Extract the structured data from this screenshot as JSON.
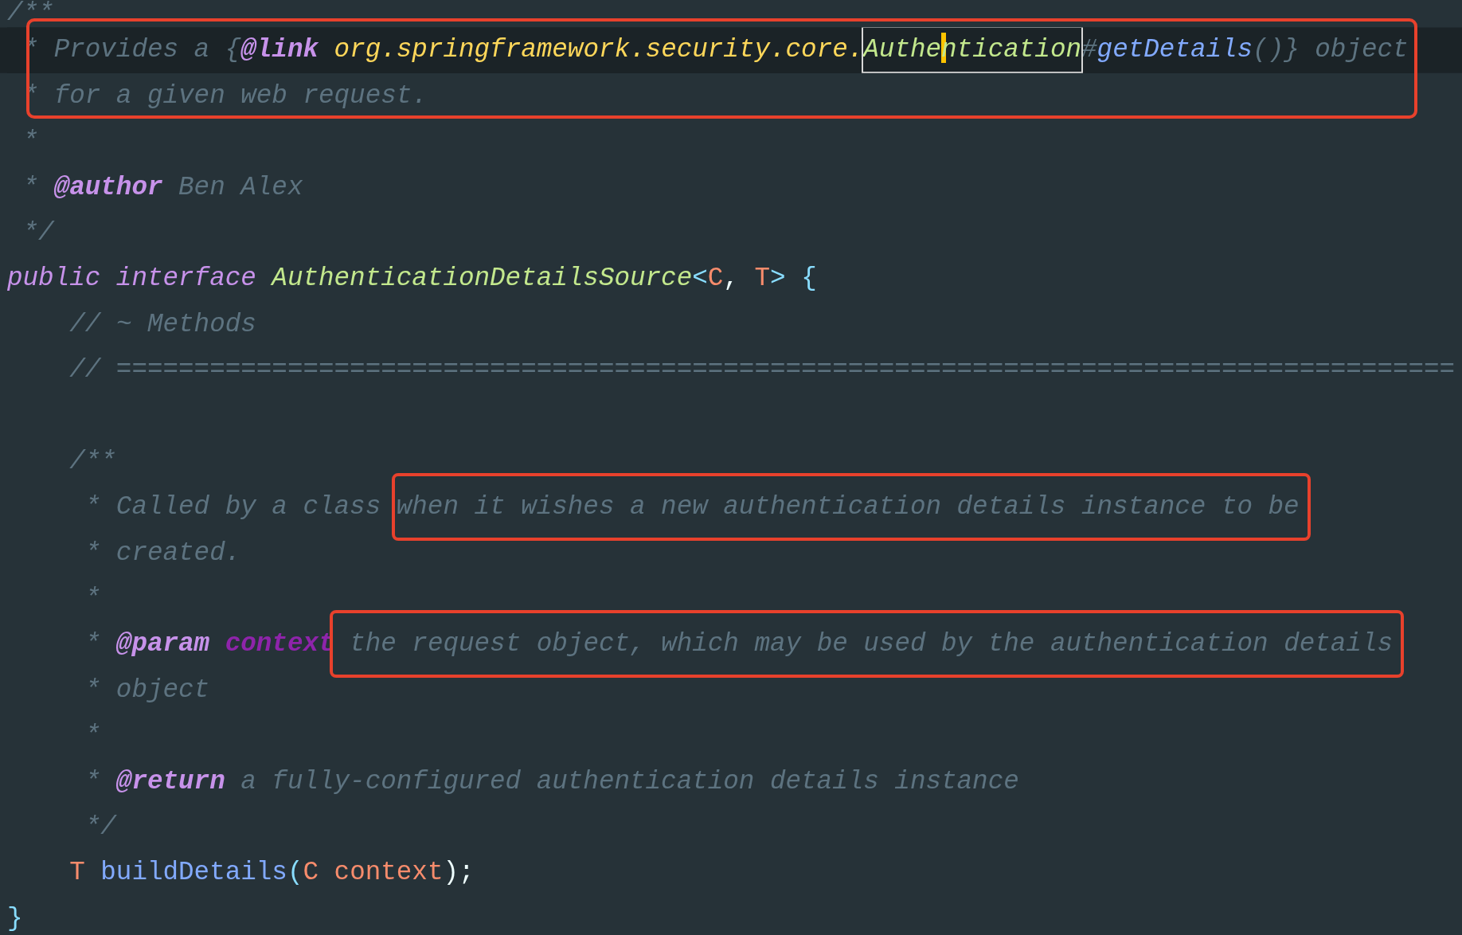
{
  "editor": {
    "lines": [
      {
        "current": false,
        "annotated": false,
        "tokens": [
          {
            "kind": "comment",
            "text": "/**"
          }
        ]
      },
      {
        "current": true,
        "annotated": true,
        "tokens": [
          {
            "kind": "comment",
            "text": " * Provides a {"
          },
          {
            "kind": "doc-tag",
            "text": "@link"
          },
          {
            "kind": "link-class",
            "text": " org.springframework.security.core."
          },
          {
            "kind": "match",
            "parts": [
              "Authe",
              "ntication"
            ]
          },
          {
            "kind": "comment",
            "text": "#"
          },
          {
            "kind": "link-member",
            "text": "getDetails"
          },
          {
            "kind": "comment",
            "text": "()} object"
          }
        ]
      },
      {
        "current": false,
        "annotated": true,
        "tokens": [
          {
            "kind": "comment",
            "text": " * for a given web request."
          }
        ]
      },
      {
        "current": false,
        "annotated": false,
        "tokens": [
          {
            "kind": "comment",
            "text": " *"
          }
        ]
      },
      {
        "current": false,
        "annotated": false,
        "tokens": [
          {
            "kind": "comment",
            "text": " * "
          },
          {
            "kind": "doc-tag",
            "text": "@author"
          },
          {
            "kind": "comment",
            "text": " Ben Alex"
          }
        ]
      },
      {
        "current": false,
        "annotated": false,
        "tokens": [
          {
            "kind": "comment",
            "text": " */"
          }
        ]
      },
      {
        "current": false,
        "annotated": false,
        "tokens": [
          {
            "kind": "keyword",
            "text": "public interface "
          },
          {
            "kind": "type-name",
            "text": "AuthenticationDetailsSource"
          },
          {
            "kind": "bracket",
            "text": "<"
          },
          {
            "kind": "type-param",
            "text": "C"
          },
          {
            "kind": "punct",
            "text": ", "
          },
          {
            "kind": "type-param",
            "text": "T"
          },
          {
            "kind": "bracket",
            "text": ">"
          },
          {
            "kind": "bracket",
            "text": " {"
          }
        ]
      },
      {
        "current": false,
        "annotated": false,
        "tokens": [
          {
            "kind": "comment",
            "text": "    // ~ Methods"
          }
        ]
      },
      {
        "current": false,
        "annotated": false,
        "tokens": [
          {
            "kind": "comment",
            "text": "    // ======================================================================================"
          }
        ]
      },
      {
        "current": false,
        "annotated": false
      },
      {
        "current": false,
        "annotated": false,
        "tokens": [
          {
            "kind": "comment",
            "text": "    /**"
          }
        ]
      },
      {
        "current": false,
        "annotated": false,
        "tokens": [
          {
            "kind": "comment",
            "text": "     * Called by a class "
          },
          {
            "kind": "comment-boxed",
            "text": "when it wishes a new authentication details instance to be"
          }
        ]
      },
      {
        "current": false,
        "annotated": false,
        "tokens": [
          {
            "kind": "comment",
            "text": "     * created."
          }
        ]
      },
      {
        "current": false,
        "annotated": false,
        "tokens": [
          {
            "kind": "comment",
            "text": "     *"
          }
        ]
      },
      {
        "current": false,
        "annotated": false,
        "tokens": [
          {
            "kind": "comment",
            "text": "     * "
          },
          {
            "kind": "doc-tag",
            "text": "@param"
          },
          {
            "kind": "param-name",
            "text": " context"
          },
          {
            "kind": "comment-boxed",
            "text": " the request object, which may be used by the authentication details"
          }
        ]
      },
      {
        "current": false,
        "annotated": false,
        "tokens": [
          {
            "kind": "comment",
            "text": "     * object"
          }
        ]
      },
      {
        "current": false,
        "annotated": false,
        "tokens": [
          {
            "kind": "comment",
            "text": "     *"
          }
        ]
      },
      {
        "current": false,
        "annotated": false,
        "tokens": [
          {
            "kind": "comment",
            "text": "     * "
          },
          {
            "kind": "doc-tag",
            "text": "@return"
          },
          {
            "kind": "comment",
            "text": " a fully-configured authentication details instance"
          }
        ]
      },
      {
        "current": false,
        "annotated": false,
        "tokens": [
          {
            "kind": "comment",
            "text": "     */"
          }
        ]
      },
      {
        "current": false,
        "annotated": false,
        "tokens": [
          {
            "kind": "type-param",
            "text": "    T"
          },
          {
            "kind": "method",
            "text": " buildDetails"
          },
          {
            "kind": "bracket",
            "text": "("
          },
          {
            "kind": "type-param",
            "text": "C"
          },
          {
            "kind": "variable",
            "text": " context"
          },
          {
            "kind": "punct",
            "text": ");"
          }
        ]
      },
      {
        "current": false,
        "annotated": false,
        "tokens": [
          {
            "kind": "bracket",
            "text": "}"
          }
        ]
      }
    ]
  }
}
